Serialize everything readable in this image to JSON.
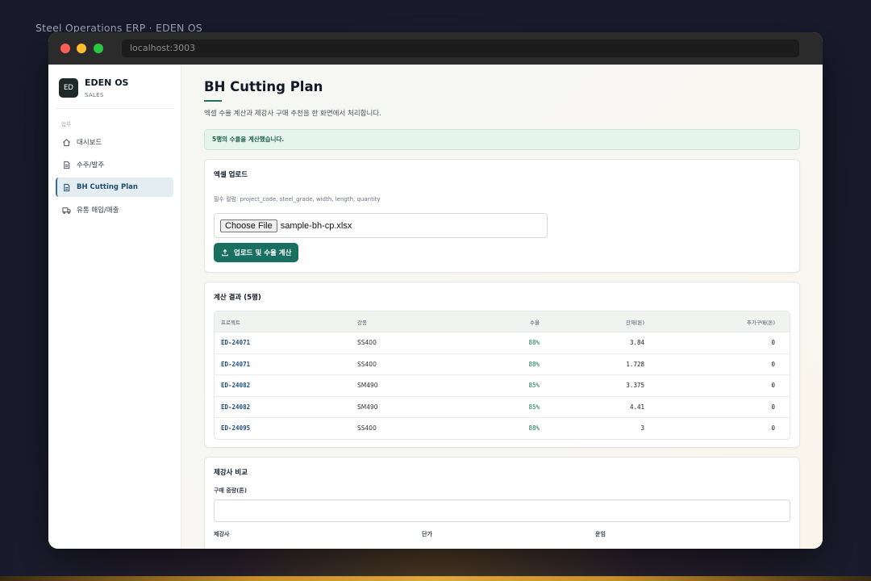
{
  "outer_title": "Steel Operations ERP · EDEN OS",
  "browser": {
    "url": "localhost:3003"
  },
  "sidebar": {
    "logo": "ED",
    "brand": "EDEN OS",
    "sub": "SALES",
    "section": "업무",
    "items": [
      {
        "label": "대시보드",
        "icon": "home-icon"
      },
      {
        "label": "수주/발주",
        "icon": "document-icon"
      },
      {
        "label": "BH Cutting Plan",
        "icon": "document-icon",
        "active": true
      },
      {
        "label": "유통 매입/매출",
        "icon": "truck-icon"
      }
    ]
  },
  "page": {
    "title": "BH Cutting Plan",
    "subtitle": "엑셀 수율 계산과 제강사 구매 추천을 한 화면에서 처리합니다.",
    "alert": "5행의 수율을 계산했습니다."
  },
  "upload": {
    "title": "엑셀 업로드",
    "hint": "필수 컬럼: project_code, steel_grade, width, length, quantity",
    "choose_label": "Choose File",
    "file_name": "sample-bh-cp.xlsx",
    "button_label": "업로드 및 수율 계산"
  },
  "results": {
    "title": "계산 결과 (5행)",
    "columns": [
      "프로젝트",
      "강종",
      "수율",
      "잔재(톤)",
      "추가구매(톤)"
    ],
    "rows": [
      [
        "ED-24071",
        "SS400",
        "88%",
        "3.84",
        "0"
      ],
      [
        "ED-24071",
        "SS400",
        "88%",
        "1.728",
        "0"
      ],
      [
        "ED-24082",
        "SM490",
        "85%",
        "3.375",
        "0"
      ],
      [
        "ED-24082",
        "SM490",
        "85%",
        "4.41",
        "0"
      ],
      [
        "ED-24095",
        "SS400",
        "88%",
        "3",
        "0"
      ]
    ]
  },
  "compare": {
    "title": "제강사 비교",
    "weight_label": "구매 중량(톤)",
    "weight_value": "",
    "mill_label": "제강사",
    "price_label": "단가",
    "freight_label": "운임"
  }
}
